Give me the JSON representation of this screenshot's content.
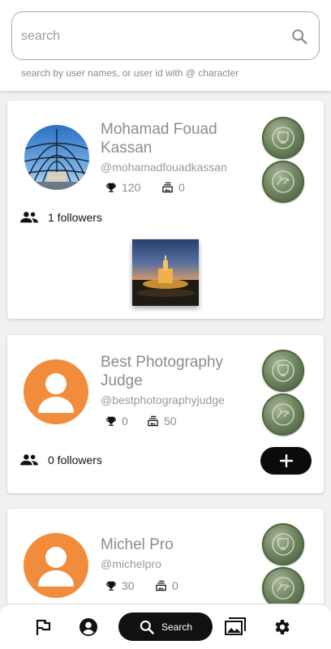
{
  "search": {
    "placeholder": "search",
    "hint": "search by user names, or user id with @ character"
  },
  "users": [
    {
      "name": "Mohamad Fouad Kassan",
      "handle": "@mohamadfouadkassan",
      "trophies": "120",
      "photos": "0",
      "followers": "1 followers"
    },
    {
      "name": "Best Photography Judge",
      "handle": "@bestphotographyjudge",
      "trophies": "0",
      "photos": "50",
      "followers": "0 followers"
    },
    {
      "name": "Michel Pro",
      "handle": "@michelpro",
      "trophies": "30",
      "photos": "0"
    }
  ],
  "nav": {
    "search_label": "Search",
    "icons": [
      "flag-icon",
      "account-icon",
      "search-icon",
      "gallery-icon",
      "settings-icon"
    ]
  },
  "colors": {
    "avatar_orange": "#f28c3d",
    "accent_black": "#111111"
  }
}
